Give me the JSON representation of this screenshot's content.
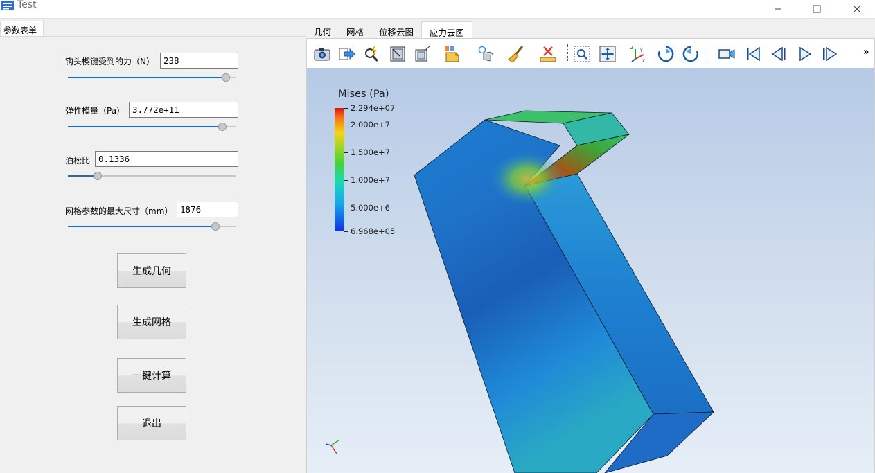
{
  "window": {
    "title": "Test"
  },
  "left": {
    "tab": "参数表单",
    "params": [
      {
        "label": "钩头楔键受到的力（N）",
        "value": "238",
        "slider_fraction": 0.965
      },
      {
        "label": "弹性模量（Pa）",
        "value": "3.772e+11",
        "slider_fraction": 0.945
      },
      {
        "label": "泊松比",
        "value": "0.1336",
        "slider_fraction": 0.16
      },
      {
        "label": "网格参数的最大尺寸（mm）",
        "value": "1876",
        "slider_fraction": 0.9
      }
    ],
    "buttons": {
      "geometry": "生成几何",
      "mesh": "生成网格",
      "compute": "一键计算",
      "exit": "退出"
    }
  },
  "tabs": [
    "几何",
    "网格",
    "位移云图",
    "应力云图"
  ],
  "active_tab": "应力云图",
  "toolbar": {
    "icons": [
      "camera-icon",
      "export-icon",
      "pick-icon",
      "zoom-box-icon",
      "wireframe-box-icon",
      "surface-box-icon",
      "light-icon",
      "clean-icon",
      "ruler-icon",
      "zoom-region-icon",
      "fit-view-icon",
      "axes-icon",
      "rotate-cw-icon",
      "rotate-ccw-icon",
      "video-camera-icon",
      "first-frame-icon",
      "prev-frame-icon",
      "play-icon",
      "next-frame-icon"
    ],
    "more": "»"
  },
  "legend": {
    "title": "Mises (Pa)",
    "ticks": [
      "2.294e+07",
      "2.000e+7",
      "1.500e+7",
      "1.000e+7",
      "5.000e+6",
      "6.968e+05"
    ]
  },
  "colors": {
    "accent": "#1e6bb8",
    "legend_max": "#d41414",
    "legend_min": "#1030e0"
  }
}
